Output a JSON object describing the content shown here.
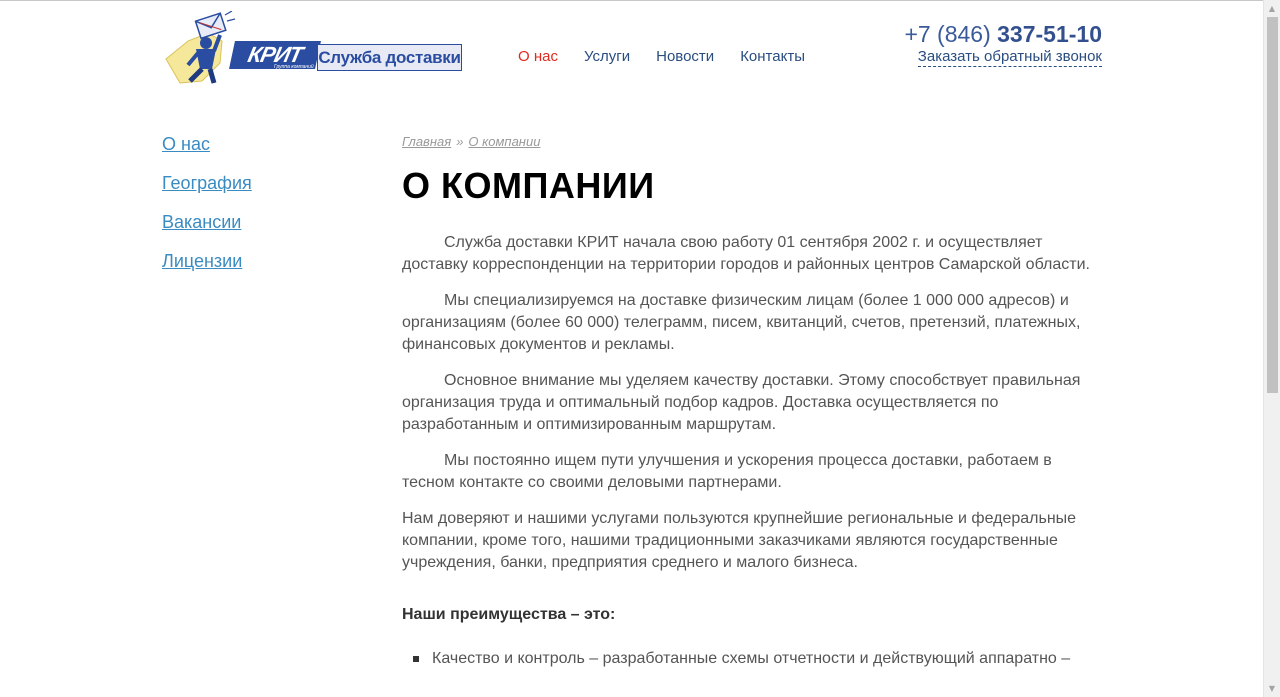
{
  "header": {
    "logo": {
      "brand": "КРИТ",
      "brand_sub": "Группа компаний",
      "service": "Служба доставки"
    },
    "nav": [
      {
        "label": "О нас",
        "active": true
      },
      {
        "label": "Услуги",
        "active": false
      },
      {
        "label": "Новости",
        "active": false
      },
      {
        "label": "Контакты",
        "active": false
      }
    ],
    "phone_prefix": "+7 (846)",
    "phone_number": "337-51-10",
    "callback": "Заказать обратный звонок"
  },
  "sidebar": {
    "items": [
      {
        "label": "О нас"
      },
      {
        "label": "География"
      },
      {
        "label": "Вакансии"
      },
      {
        "label": "Лицензии"
      }
    ]
  },
  "breadcrumb": {
    "home": "Главная",
    "separator": "»",
    "current": "О компании"
  },
  "main": {
    "title": "О КОМПАНИИ",
    "paragraphs": [
      "Служба доставки КРИТ начала свою работу 01 сентября 2002 г. и осуществляет доставку корреспонденции на территории городов и районных центров Самарской области.",
      "Мы специализируемся на доставке физическим лицам (более 1 000 000 адресов) и организациям (более 60 000) телеграмм, писем, квитанций, счетов, претензий, платежных, финансовых документов и рекламы.",
      "Основное внимание мы уделяем качеству доставки. Этому способствует правильная организация труда и оптимальный подбор кадров. Доставка осуществляется по разработанным и оптимизированным маршрутам.",
      "Мы постоянно ищем пути улучшения и ускорения процесса доставки, работаем в тесном контакте со своими деловыми партнерами.",
      "Нам доверяют и нашими услугами пользуются крупнейшие региональные и федеральные компании, кроме того, нашими традиционными заказчиками являются государственные учреждения, банки, предприятия среднего и малого бизнеса."
    ],
    "advantages_heading": "Наши преимущества – это:",
    "advantages": [
      "Качество и контроль – разработанные схемы отчетности и действующий аппаратно –"
    ]
  },
  "colors": {
    "nav_active": "#e02a1f",
    "nav_link": "#2a4d80",
    "sidebar_link": "#3a8bc2",
    "brand_blue": "#2a4da1"
  }
}
